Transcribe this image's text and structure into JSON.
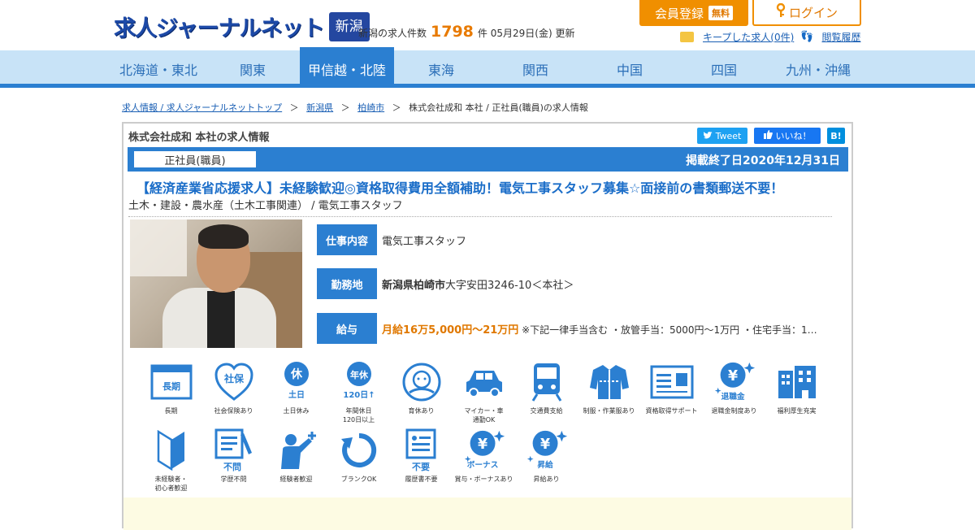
{
  "header": {
    "logo_text": "求人ジャーナルネット",
    "region": "新潟",
    "count_prefix": "新潟の求人件数",
    "count": "1798",
    "count_suffix": "件 05月29日(金) 更新",
    "register_label": "会員登録",
    "free_badge": "無料",
    "login_label": "ログイン",
    "kept_jobs_label": "キープした求人(0件)",
    "history_label": "閲覧履歴"
  },
  "nav": {
    "items": [
      "北海道・東北",
      "関東",
      "甲信越・北陸",
      "東海",
      "関西",
      "中国",
      "四国",
      "九州・沖縄"
    ],
    "active_index": 2
  },
  "breadcrumb": {
    "items": [
      "求人情報 / 求人ジャーナルネットトップ",
      "新潟県",
      "柏崎市"
    ],
    "current": "株式会社成和 本社 / 正社員(職員)の求人情報",
    "sep": "＞"
  },
  "job": {
    "heading": "株式会社成和 本社の求人情報",
    "share": {
      "tweet": "Tweet",
      "like": "いいね！",
      "hatena": "B!"
    },
    "employment_type": "正社員(職員)",
    "end_date": "掲載終了日2020年12月31日",
    "title": "【経済産業省応援求人】未経験歓迎◎資格取得費用全額補助！電気工事スタッフ募集☆面接前の書類郵送不要！",
    "category": "土木・建設・農水産（土木工事関連） / 電気工事スタッフ",
    "rows": [
      {
        "label": "仕事内容",
        "value": "電気工事スタッフ"
      },
      {
        "label": "勤務地",
        "value_bold": "新潟県柏崎市",
        "value": "大字安田3246-10＜本社＞"
      },
      {
        "label": "給与",
        "value_salary": "月給16万5,000円～21万円",
        "value": " ※下記一律手当含む ・放管手当：5000円～1万円 ・住宅手当：1…"
      }
    ]
  },
  "features": [
    {
      "icon": "long-term-icon",
      "icon_text": "長期",
      "label": "長期"
    },
    {
      "icon": "social-insurance-icon",
      "icon_text": "社保",
      "label": "社会保険あり"
    },
    {
      "icon": "weekend-off-icon",
      "icon_text": "休",
      "icon_sub": "土日",
      "label": "土日休み"
    },
    {
      "icon": "annual-holidays-icon",
      "icon_text": "年休",
      "icon_sub": "120日↑",
      "label": "年間休日\n120日以上"
    },
    {
      "icon": "childcare-leave-icon",
      "icon_text": "",
      "label": "育休あり"
    },
    {
      "icon": "car-commute-icon",
      "icon_text": "",
      "label": "マイカー・車\n通勤OK"
    },
    {
      "icon": "transport-allowance-icon",
      "icon_text": "",
      "label": "交通費支給"
    },
    {
      "icon": "uniform-icon",
      "icon_text": "",
      "label": "制服・作業服あり"
    },
    {
      "icon": "qualification-support-icon",
      "icon_text": "",
      "label": "資格取得サポート"
    },
    {
      "icon": "retirement-allowance-icon",
      "icon_text": "¥",
      "icon_sub": "退職金",
      "label": "退職金制度あり"
    },
    {
      "icon": "welfare-icon",
      "icon_text": "",
      "label": "福利厚生充実"
    },
    {
      "icon": "beginner-icon",
      "icon_text": "",
      "label": "未経験者・\n初心者歓迎"
    },
    {
      "icon": "education-any-icon",
      "icon_text": "不問",
      "label": "学歴不問"
    },
    {
      "icon": "experienced-welcome-icon",
      "icon_text": "",
      "label": "経験者歓迎"
    },
    {
      "icon": "blank-ok-icon",
      "icon_text": "",
      "label": "ブランクOK"
    },
    {
      "icon": "no-resume-icon",
      "icon_text": "不要",
      "label": "履歴書不要"
    },
    {
      "icon": "bonus-icon",
      "icon_text": "¥",
      "icon_sub": "ボーナス",
      "label": "賞与・ボーナスあり"
    },
    {
      "icon": "raise-icon",
      "icon_text": "¥",
      "icon_sub": "昇給",
      "label": "昇給あり"
    }
  ],
  "colors": {
    "brand": "#2b7fd1",
    "accent": "#f08f00",
    "nav_bg": "#c8e3f7"
  }
}
